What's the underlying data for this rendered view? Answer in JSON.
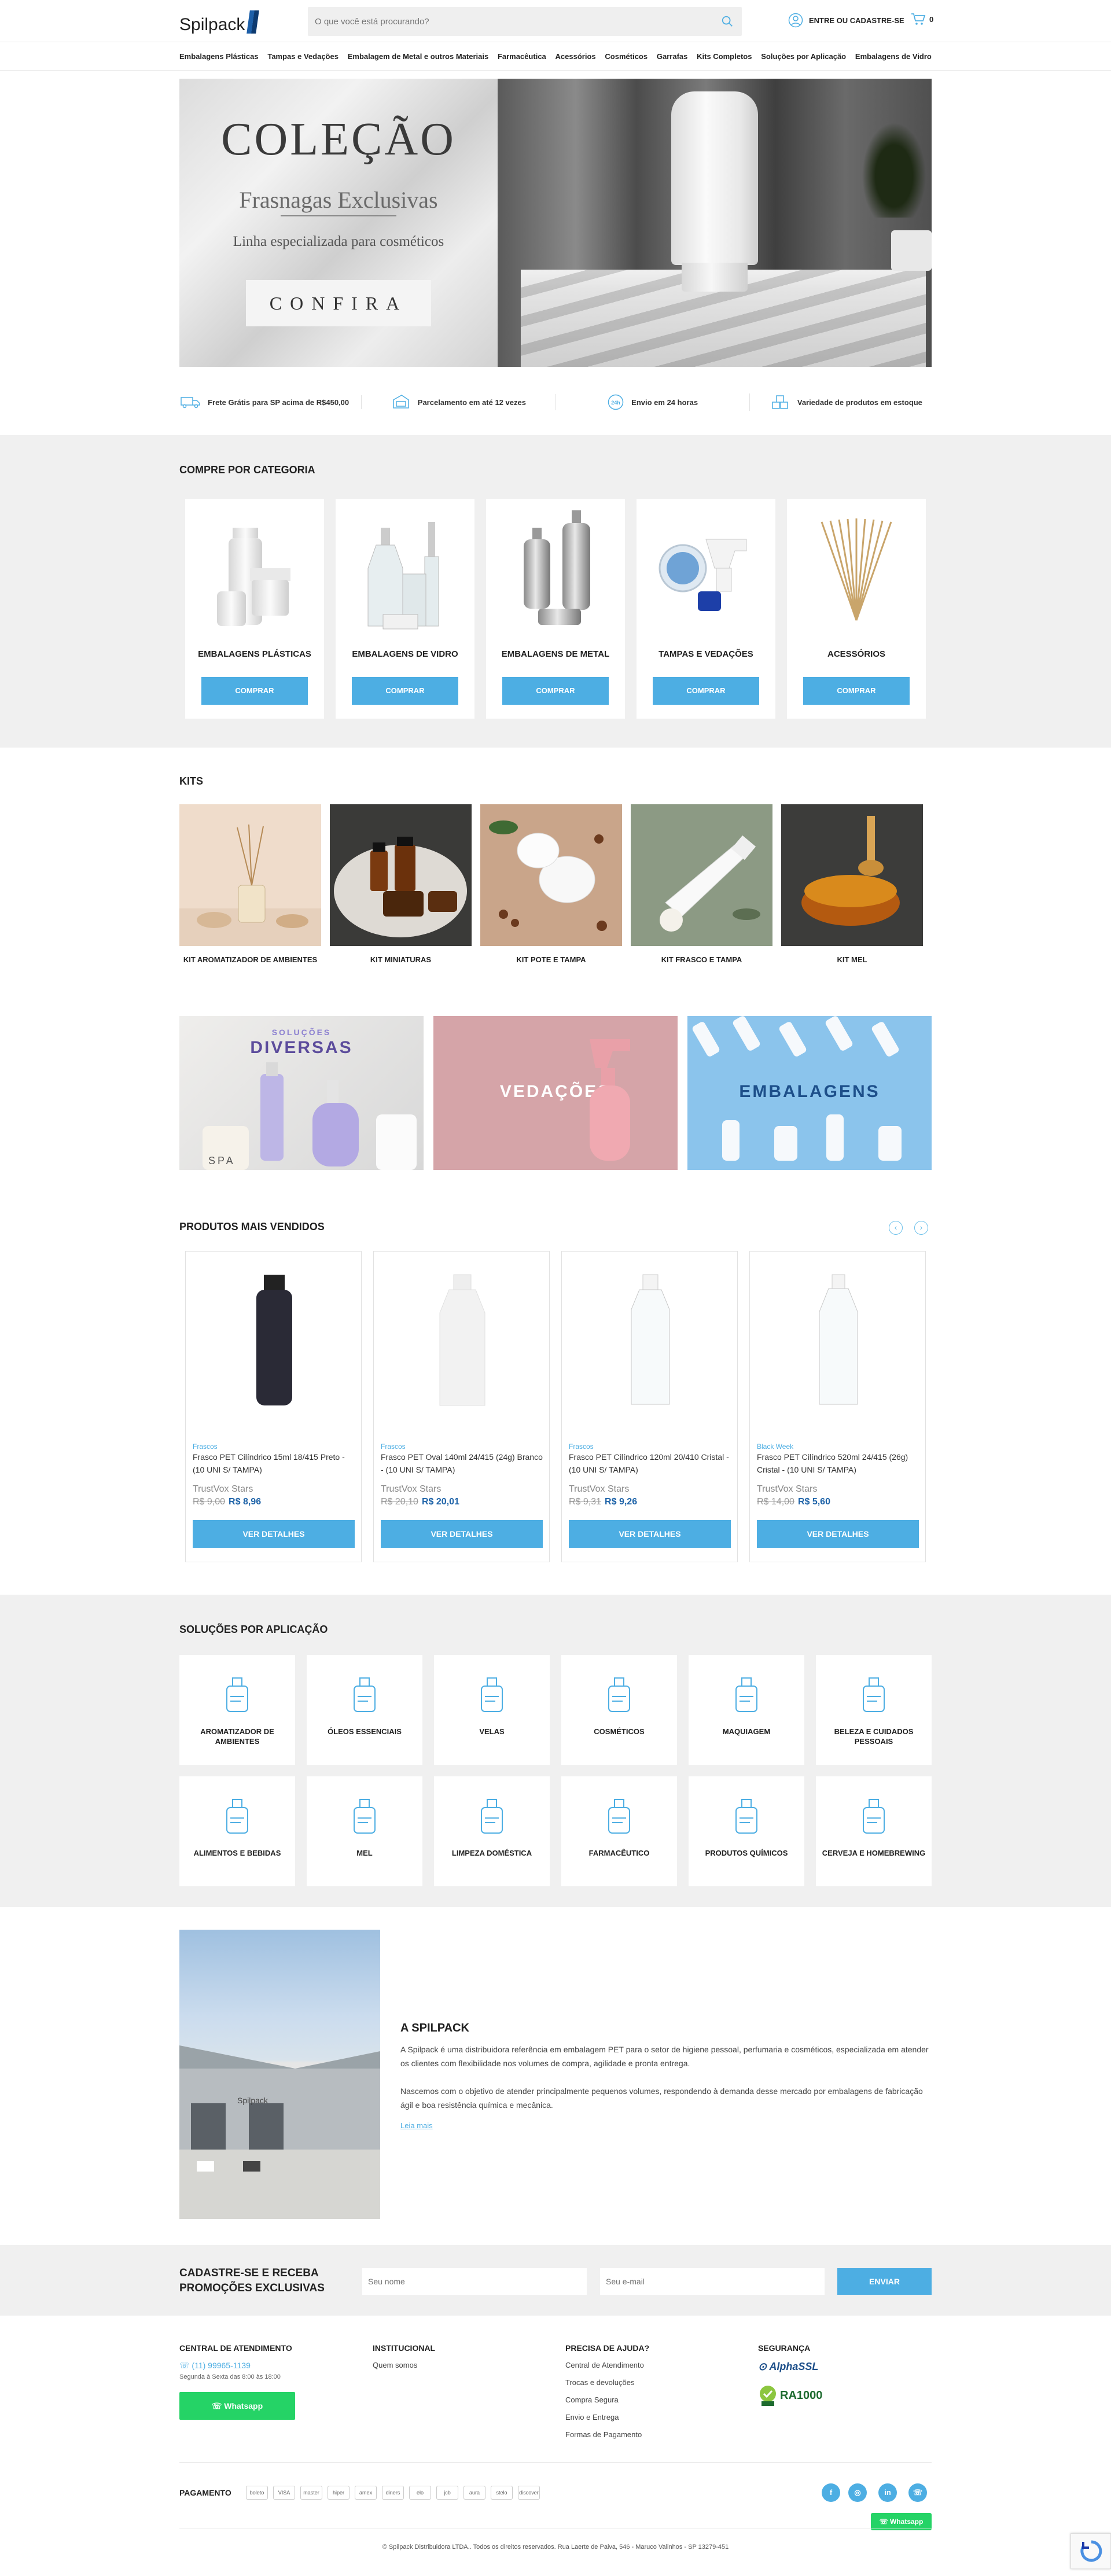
{
  "header": {
    "logo": "Spilpack",
    "search_placeholder": "O que você está procurando?",
    "account": "ENTRE OU CADASTRE-SE",
    "cart_count": "0"
  },
  "nav": [
    "Embalagens Plásticas",
    "Tampas e Vedações",
    "Embalagem de Metal e outros Materiais",
    "Farmacêutica",
    "Acessórios",
    "Cosméticos",
    "Garrafas",
    "Kits Completos",
    "Soluções por Aplicação",
    "Embalagens de Vidro"
  ],
  "banner": {
    "title": "COLEÇÃO",
    "subtitle": "Frasnagas Exclusivas",
    "subtitle2": "Linha especializada para cosméticos",
    "button": "CONFIRA"
  },
  "benefits": [
    "Frete Grátis para SP acima de R$450,00",
    "Parcelamento em até 12 vezes",
    "Envio em 24 horas",
    "Variedade de produtos em estoque"
  ],
  "categories": {
    "title": "COMPRE POR CATEGORIA",
    "button": "COMPRAR",
    "items": [
      "EMBALAGENS PLÁSTICAS",
      "EMBALAGENS DE VIDRO",
      "EMBALAGENS DE METAL",
      "TAMPAS E VEDAÇÕES",
      "ACESSÓRIOS"
    ]
  },
  "kits": {
    "title": "KITS",
    "items": [
      "KIT AROMATIZADOR DE AMBIENTES",
      "KIT MINIATURAS",
      "KIT POTE E TAMPA",
      "KIT FRASCO E TAMPA",
      "KIT MEL"
    ]
  },
  "promos": {
    "solucoes_top": "SOLUÇÕES",
    "solucoes_bottom": "DIVERSAS",
    "vedacoes": "VEDAÇÕES",
    "embalagens": "EMBALAGENS",
    "spa": "SPA"
  },
  "products": {
    "title": "PRODUTOS MAIS VENDIDOS",
    "button": "VER DETALHES",
    "stars": "TrustVox Stars",
    "items": [
      {
        "category": "Frascos",
        "name": "Frasco PET Cilíndrico 15ml 18/415 Preto - (10 UNI S/ TAMPA)",
        "old": "R$ 9,00",
        "price": "R$ 8,96"
      },
      {
        "category": "Frascos",
        "name": "Frasco PET Oval 140ml 24/415 (24g) Branco - (10 UNI S/ TAMPA)",
        "old": "R$ 20,10",
        "price": "R$ 20,01"
      },
      {
        "category": "Frascos",
        "name": "Frasco PET Cilíndrico 120ml 20/410 Cristal - (10 UNI S/ TAMPA)",
        "old": "R$ 9,31",
        "price": "R$ 9,26"
      },
      {
        "category": "Black Week",
        "name": "Frasco PET Cilíndrico 520ml 24/415 (26g) Cristal - (10 UNI S/ TAMPA)",
        "old": "R$ 14,00",
        "price": "R$ 5,60"
      }
    ]
  },
  "applications": {
    "title": "SOLUÇÕES POR APLICAÇÃO",
    "items": [
      "AROMATIZADOR DE AMBIENTES",
      "ÓLEOS ESSENCIAIS",
      "VELAS",
      "COSMÉTICOS",
      "MAQUIAGEM",
      "BELEZA E CUIDADOS PESSOAIS",
      "ALIMENTOS E BEBIDAS",
      "MEL",
      "LIMPEZA DOMÉSTICA",
      "FARMACÊUTICO",
      "PRODUTOS QUÍMICOS",
      "CERVEJA E HOMEBREWING"
    ]
  },
  "about": {
    "title": "A SPILPACK",
    "p1": "A Spilpack é uma distribuidora referência em embalagem PET para o setor de higiene pessoal, perfumaria e cosméticos, especializada em atender os clientes com flexibilidade nos volumes de compra, agilidade e pronta entrega.",
    "p2": "Nascemos com o objetivo de atender principalmente pequenos volumes, respondendo à demanda desse mercado por embalagens de fabricação ágil e boa resistência química e mecânica.",
    "link": "Leia mais",
    "sign": "Spilpack"
  },
  "newsletter": {
    "title_line1": "CADASTRE-SE E RECEBA",
    "title_line2": "PROMOÇÕES EXCLUSIVAS",
    "name_placeholder": "Seu nome",
    "email_placeholder": "Seu e-mail",
    "button": "ENVIAR"
  },
  "footer": {
    "central_title": "CENTRAL DE ATENDIMENTO",
    "phone": "(11) 99965-1139",
    "hours": "Segunda à Sexta das 8:00 às 18:00",
    "whatsapp": "Whatsapp",
    "inst_title": "INSTITUCIONAL",
    "inst_links": [
      "Quem somos"
    ],
    "help_title": "PRECISA DE AJUDA?",
    "help_links": [
      "Central de Atendimento",
      "Trocas e devoluções",
      "Compra Segura",
      "Envio e Entrega",
      "Formas de Pagamento"
    ],
    "security_title": "SEGURANÇA",
    "alphassl": "AlphaSSL",
    "ra1000": "RA1000",
    "payment_title": "PAGAMENTO",
    "payments": [
      "boleto",
      "VISA",
      "master",
      "hiper",
      "amex",
      "diners",
      "elo",
      "jcb",
      "aura",
      "stelo",
      "discover"
    ],
    "copyright": "© Spilpack Distribuidora LTDA.. Todos os direitos reservados. Rua Laerte de Paiva, 546 - Maruco Valinhos - SP 13279-451"
  },
  "colors": {
    "accent": "#4daee3",
    "price": "#1e63a8",
    "whatsapp": "#25d366",
    "section_bg": "#f0f0f0"
  }
}
